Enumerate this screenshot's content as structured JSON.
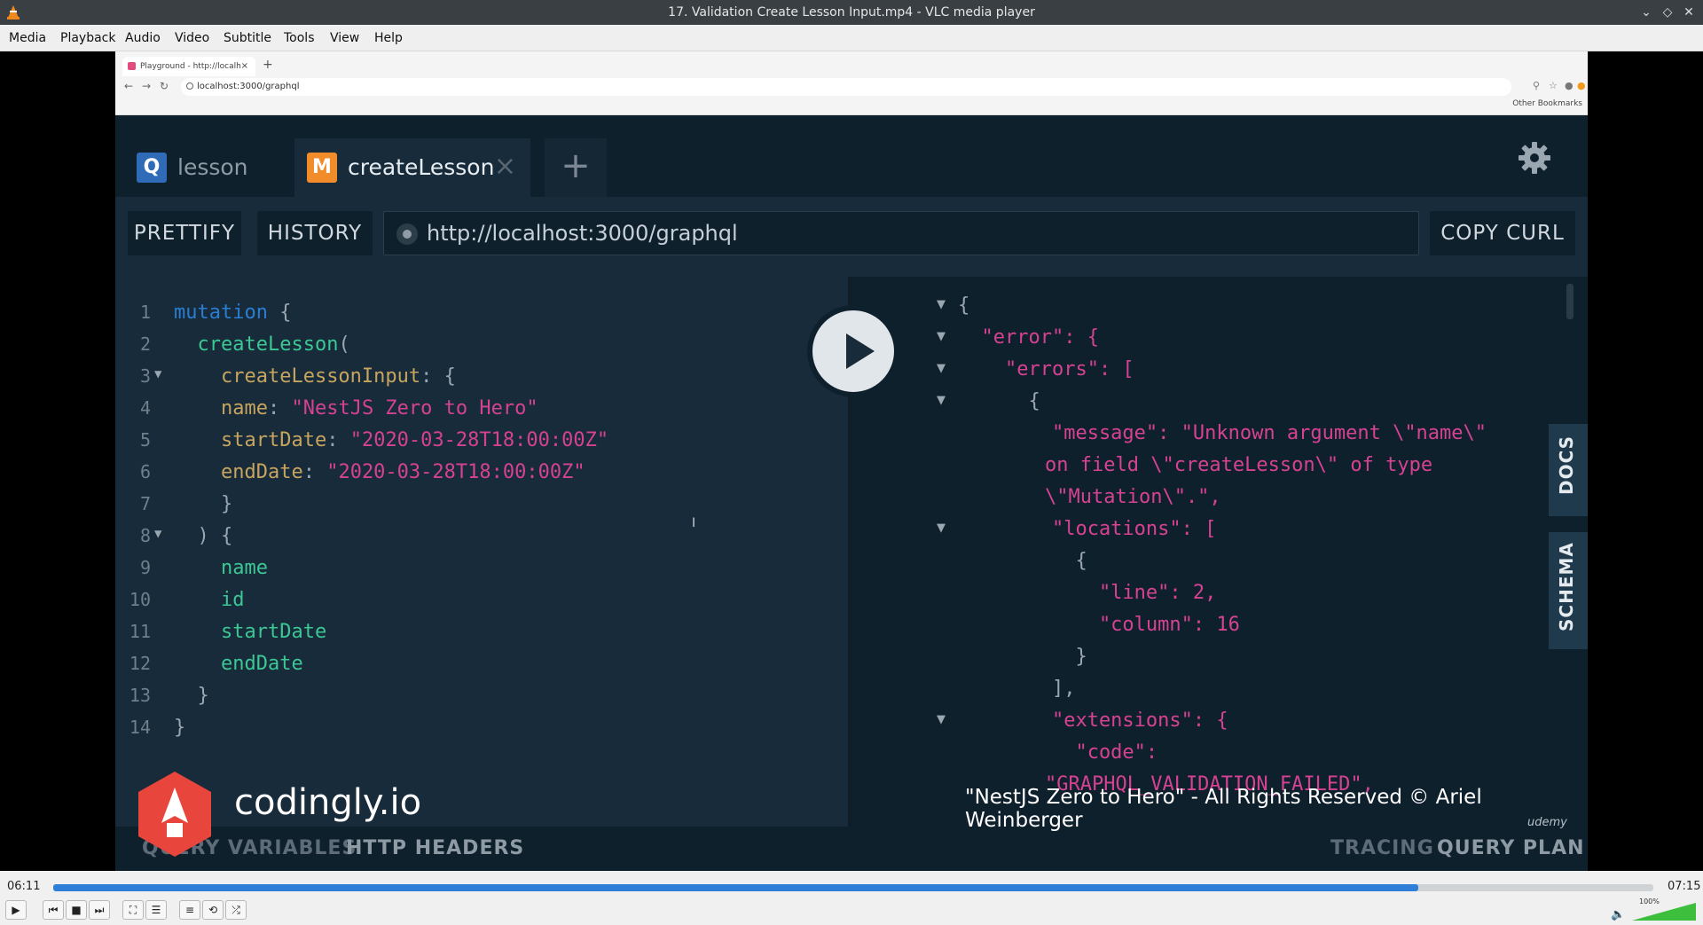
{
  "window": {
    "title": "17. Validation Create Lesson Input.mp4 - VLC media player"
  },
  "menu": {
    "items": [
      "Media",
      "Playback",
      "Audio",
      "Video",
      "Subtitle",
      "Tools",
      "View",
      "Help"
    ]
  },
  "browser": {
    "tab_title": "Playground - http://localh",
    "address": "localhost:3000/graphql",
    "bookmarks_label": "Other Bookmarks"
  },
  "playground": {
    "tabs": [
      {
        "badge": "Q",
        "label": "lesson",
        "badge_color": "#2f6bb7"
      },
      {
        "badge": "M",
        "label": "createLesson",
        "badge_color": "#f28c2a"
      }
    ],
    "add_tab_label": "+",
    "prettify_label": "PRETTIFY",
    "history_label": "HISTORY",
    "endpoint_url": "http://localhost:3000/graphql",
    "copy_curl_label": "COPY CURL",
    "docs_label": "DOCS",
    "schema_label": "SCHEMA",
    "query_variables_label": "QUERY VARIABLES",
    "http_headers_label": "HTTP HEADERS",
    "tracing_label": "TRACING",
    "query_plan_label": "QUERY PLAN"
  },
  "editor": {
    "lines": [
      {
        "n": "1",
        "text": "mutation {"
      },
      {
        "n": "2",
        "text": "  createLesson("
      },
      {
        "n": "3",
        "text": "    createLessonInput: {"
      },
      {
        "n": "4",
        "text": "    name: \"NestJS Zero to Hero\""
      },
      {
        "n": "5",
        "text": "    startDate: \"2020-03-28T18:00:00Z\""
      },
      {
        "n": "6",
        "text": "    endDate: \"2020-03-28T18:00:00Z\""
      },
      {
        "n": "7",
        "text": "    }"
      },
      {
        "n": "8",
        "text": "  ) {"
      },
      {
        "n": "9",
        "text": "    name"
      },
      {
        "n": "10",
        "text": "    id"
      },
      {
        "n": "11",
        "text": "    startDate"
      },
      {
        "n": "12",
        "text": "    endDate"
      },
      {
        "n": "13",
        "text": "  }"
      },
      {
        "n": "14",
        "text": "}"
      }
    ]
  },
  "result": {
    "lines": [
      "{",
      "  \"error\": {",
      "    \"errors\": [",
      "      {",
      "        \"message\": \"Unknown argument \\\"name\\\"",
      "on field \\\"createLesson\\\" of type",
      "\\\"Mutation\\\".\",",
      "        \"locations\": [",
      "          {",
      "            \"line\": 2,",
      "            \"column\": 16",
      "          }",
      "        ],",
      "        \"extensions\": {",
      "          \"code\":",
      "\"GRAPHQL_VALIDATION_FAILED\","
    ]
  },
  "overlay": {
    "brand": "codingly.io",
    "copyright": "\"NestJS Zero to Hero\" - All Rights Reserved © Ariel Weinberger",
    "udemy": "udemy"
  },
  "player": {
    "elapsed": "06:11",
    "total": "07:15",
    "progress_fraction": 0.853,
    "volume_label": "100%"
  }
}
